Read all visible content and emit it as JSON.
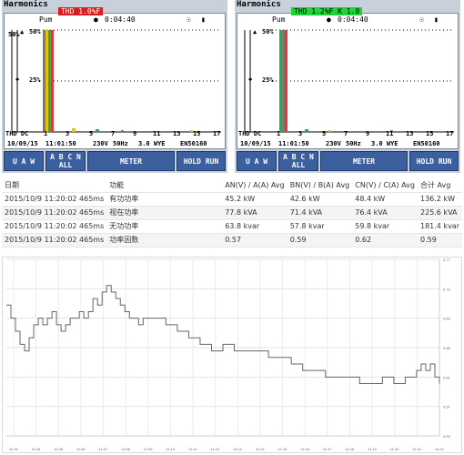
{
  "left_panel": {
    "title": "Harmonics",
    "status": "THD 1.0%F",
    "mode": "Pum",
    "timer": "0:04:40",
    "icons": [
      "plug-icon",
      "battery-icon"
    ],
    "y_top": "50%",
    "y_mid": "25%",
    "left_tag": "THD DC",
    "x_ticks": [
      "1",
      "3",
      "5",
      "7",
      "9",
      "11",
      "13",
      "15",
      "17"
    ],
    "date": "10/09/15",
    "time": "11:01:50",
    "voltage": "230V",
    "freq": "50Hz",
    "config": "3.0 WYE",
    "standard": "EN50160",
    "softkeys": [
      "U A W",
      "A B C N ALL",
      "METER",
      "HOLD RUN"
    ]
  },
  "right_panel": {
    "title": "Harmonics",
    "status": "THD 1.2%F K 1.0",
    "mode": "Pum",
    "timer": "0:04:40",
    "icons": [
      "plug-icon",
      "battery-icon"
    ],
    "y_top": "50%",
    "y_mid": "25%",
    "left_tag": "THD DC",
    "x_ticks": [
      "1",
      "3",
      "5",
      "7",
      "9",
      "11",
      "13",
      "15",
      "17"
    ],
    "date": "10/09/15",
    "time": "11:01:50",
    "voltage": "230V",
    "freq": "50Hz",
    "config": "3.0 WYE",
    "standard": "EN50160",
    "softkeys": [
      "U A W",
      "A B C N ALL",
      "METER",
      "HOLD RUN"
    ]
  },
  "table": {
    "headers": [
      "日期",
      "功能",
      "AN(V) / A(A) Avg",
      "BN(V) / B(A) Avg",
      "CN(V) / C(A) Avg",
      "合计 Avg"
    ],
    "rows": [
      [
        "2015/10/9 11:20:02 465ms",
        "有功功率",
        "45.2 kW",
        "42.6 kW",
        "48.4 kW",
        "136.2 kW"
      ],
      [
        "2015/10/9 11:20:02 465ms",
        "视在功率",
        "77.8 kVA",
        "71.4 kVA",
        "76.4 kVA",
        "225.6 kVA"
      ],
      [
        "2015/10/9 11:20:02 465ms",
        "无功功率",
        "63.8 kvar",
        "57.8 kvar",
        "59.8 kvar",
        "181.4 kvar"
      ],
      [
        "2015/10/9 11:20:02 465ms",
        "功率因数",
        "0.57",
        "0.59",
        "0.62",
        "0.59"
      ]
    ]
  },
  "chart_data": {
    "type": "line",
    "title": "",
    "xlabel": "",
    "ylabel": "",
    "ylim": [
      0.5,
      0.77
    ],
    "yticks": [
      "0.77",
      "0.73",
      "0.69",
      "0.65",
      "0.61",
      "0.57",
      "0.53"
    ],
    "xticks": [
      "11:03",
      "11:04",
      "11:05",
      "11:06",
      "11:07",
      "11:08",
      "11:09",
      "11:10",
      "11:11",
      "11:12",
      "11:13",
      "11:14",
      "11:15",
      "11:16",
      "11:17",
      "11:18",
      "11:19",
      "11:20",
      "11:21",
      "11:22"
    ],
    "series": [
      {
        "name": "",
        "color": "#666666",
        "x": [
          0,
          0.2,
          0.4,
          0.6,
          0.8,
          1.0,
          1.2,
          1.4,
          1.6,
          1.8,
          2.0,
          2.2,
          2.4,
          2.6,
          2.8,
          3.0,
          3.2,
          3.4,
          3.6,
          3.8,
          4.0,
          4.2,
          4.4,
          4.6,
          4.8,
          5.0,
          5.2,
          5.4,
          5.6,
          5.8,
          6.0,
          6.2,
          6.4,
          6.6,
          6.8,
          7.0,
          7.5,
          8.0,
          8.5,
          9.0,
          9.5,
          10.0,
          10.5,
          11.0,
          11.5,
          12.0,
          12.5,
          13.0,
          13.5,
          14.0,
          14.5,
          15.0,
          15.5,
          16.0,
          16.5,
          17.0,
          17.5,
          18.0,
          18.2,
          18.4,
          18.6,
          18.8,
          19.0
        ],
        "y": [
          0.7,
          0.68,
          0.66,
          0.64,
          0.63,
          0.65,
          0.67,
          0.68,
          0.67,
          0.68,
          0.69,
          0.67,
          0.66,
          0.67,
          0.68,
          0.68,
          0.69,
          0.68,
          0.69,
          0.71,
          0.7,
          0.72,
          0.73,
          0.72,
          0.71,
          0.7,
          0.69,
          0.68,
          0.68,
          0.67,
          0.68,
          0.68,
          0.68,
          0.68,
          0.68,
          0.67,
          0.66,
          0.65,
          0.64,
          0.63,
          0.64,
          0.63,
          0.63,
          0.63,
          0.62,
          0.62,
          0.61,
          0.6,
          0.6,
          0.59,
          0.59,
          0.59,
          0.58,
          0.58,
          0.59,
          0.58,
          0.59,
          0.6,
          0.61,
          0.6,
          0.61,
          0.59,
          0.58
        ]
      }
    ]
  }
}
